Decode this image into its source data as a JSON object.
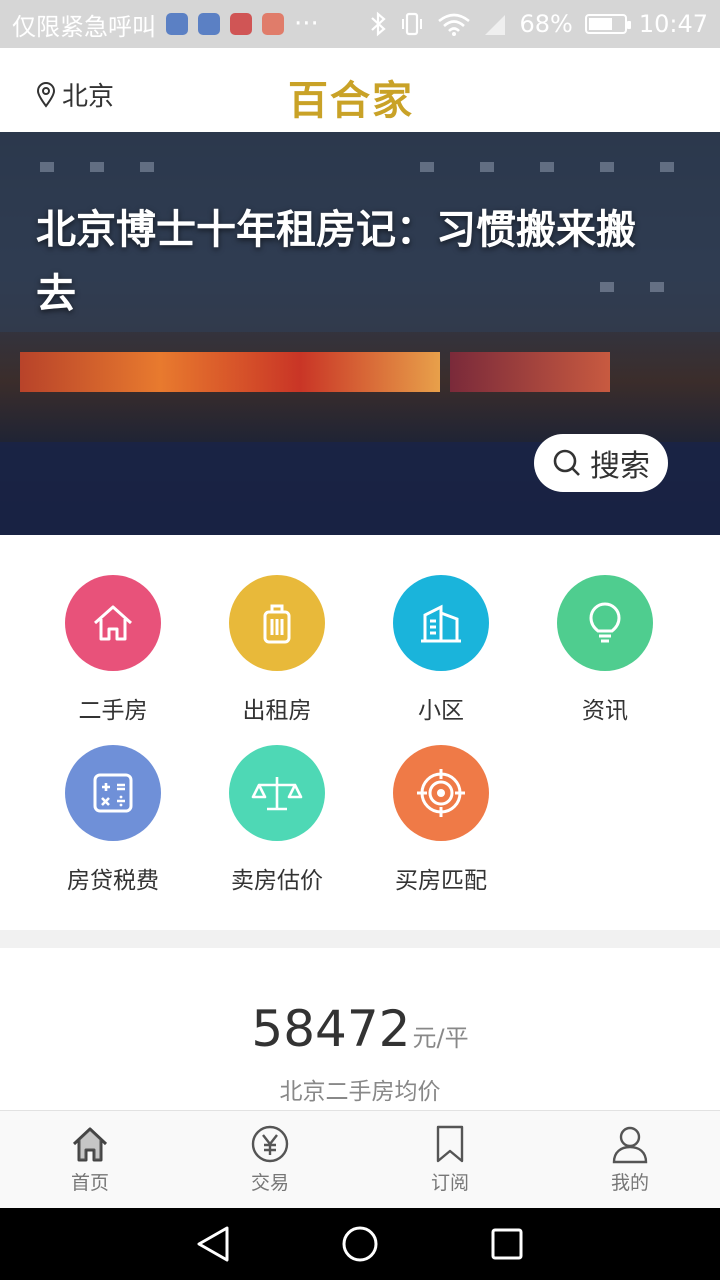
{
  "status_bar": {
    "carrier": "仅限紧急呼叫",
    "more": "···",
    "battery": "68%",
    "battery_level": 0.68,
    "time": "10:47"
  },
  "header": {
    "location": "北京",
    "logo": "百合家"
  },
  "banner": {
    "headline": "北京博士十年租房记：习惯搬来搬去",
    "search_label": "搜索"
  },
  "menu": {
    "items": [
      {
        "label": "二手房",
        "color": "#e8527a",
        "icon": "house-icon"
      },
      {
        "label": "出租房",
        "color": "#e8b93a",
        "icon": "luggage-icon"
      },
      {
        "label": "小区",
        "color": "#1ab4db",
        "icon": "building-icon"
      },
      {
        "label": "资讯",
        "color": "#4fcd8f",
        "icon": "lightbulb-icon"
      },
      {
        "label": "房贷税费",
        "color": "#6f90d8",
        "icon": "calculator-icon"
      },
      {
        "label": "卖房估价",
        "color": "#4ed8b5",
        "icon": "scale-icon"
      },
      {
        "label": "买房匹配",
        "color": "#ef7a47",
        "icon": "target-icon"
      }
    ]
  },
  "price": {
    "value": "58472",
    "unit": "元/平",
    "caption": "北京二手房均价"
  },
  "tabbar": {
    "items": [
      {
        "label": "首页",
        "icon": "home-icon"
      },
      {
        "label": "交易",
        "icon": "yuan-icon"
      },
      {
        "label": "订阅",
        "icon": "bookmark-icon"
      },
      {
        "label": "我的",
        "icon": "user-icon"
      }
    ]
  }
}
